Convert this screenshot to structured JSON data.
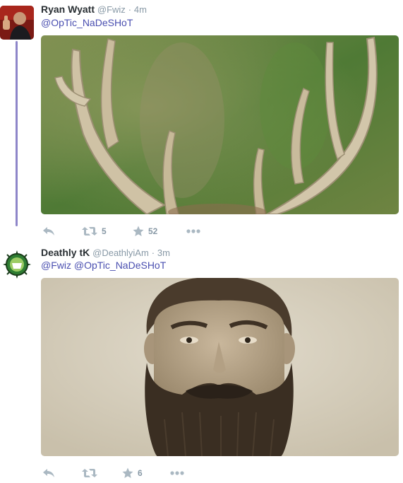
{
  "tweets": [
    {
      "fullname": "Ryan Wyatt",
      "username": "@Fwiz",
      "separator": "·",
      "time": "4m",
      "mentions": [
        "@OpTic_NaDeSHoT"
      ],
      "media_icon": "deer-antlers-photo",
      "actions": {
        "reply_icon": "reply-icon",
        "retweet_count": "5",
        "favorite_count": "52",
        "more_icon": "more-icon"
      }
    },
    {
      "fullname": "Deathly tK",
      "username": "@DeathlyiAm",
      "separator": "·",
      "time": "3m",
      "mentions": [
        "@Fwiz",
        "@OpTic_NaDeSHoT"
      ],
      "media_icon": "bearded-man-portrait-photo",
      "actions": {
        "reply_icon": "reply-icon",
        "retweet_count": "",
        "favorite_count": "6",
        "more_icon": "more-icon"
      }
    }
  ],
  "colors": {
    "thread_line": "#8e86c9",
    "link": "#3a46a3",
    "muted": "#8899a6",
    "icon": "#aab8c2"
  }
}
